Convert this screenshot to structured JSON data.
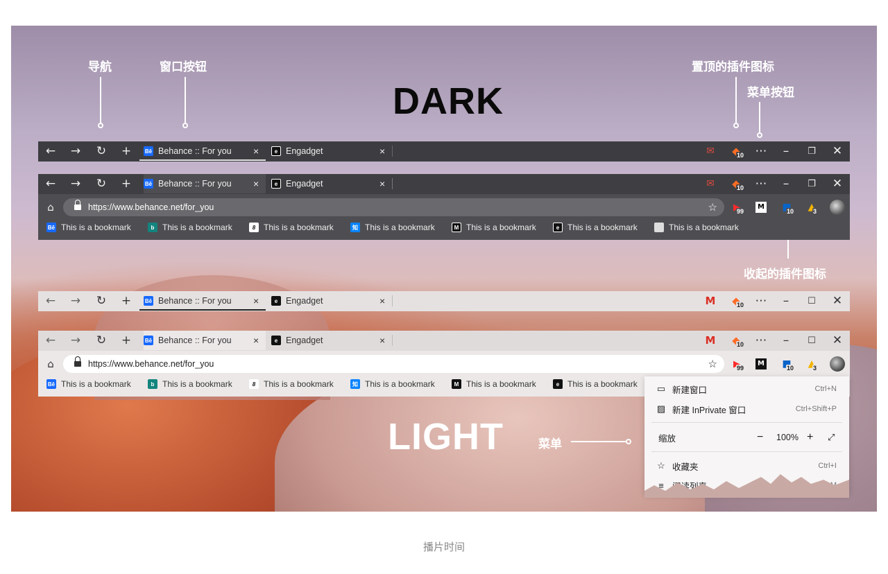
{
  "annotations": {
    "nav": "导航",
    "window_buttons": "窗口按钮",
    "pinned_extensions": "置顶的插件图标",
    "menu_button": "菜单按钮",
    "collapsed_extensions": "收起的插件图标",
    "menu": "菜单"
  },
  "headings": {
    "dark": "DARK",
    "light": "LIGHT"
  },
  "tabs": [
    {
      "label": "Behance :: For you",
      "favicon": "Bē",
      "active": true
    },
    {
      "label": "Engadget",
      "favicon": "e",
      "active": false
    }
  ],
  "address": {
    "url": "https://www.behance.net/for_you"
  },
  "extensions_pinned": [
    {
      "icon": "gmail-icon"
    },
    {
      "icon": "gitlab-icon",
      "badge": "10"
    }
  ],
  "extensions_toolbar": [
    {
      "icon": "youtube-icon",
      "badge": "99"
    },
    {
      "icon": "medium-icon"
    },
    {
      "icon": "outlook-icon",
      "badge": "10"
    },
    {
      "icon": "drive-icon",
      "badge": "3"
    },
    {
      "icon": "avatar"
    }
  ],
  "bookmarks": [
    {
      "label": "This is a bookmark",
      "icon": "Bē",
      "color": "#1769ff"
    },
    {
      "label": "This is a bookmark",
      "icon": "b",
      "color": "#13847e"
    },
    {
      "label": "This is a bookmark",
      "icon": "8",
      "color": "#111111"
    },
    {
      "label": "This is a bookmark",
      "icon": "知",
      "color": "#0a84ff"
    },
    {
      "label": "This is a bookmark",
      "icon": "M",
      "color": "#111111"
    },
    {
      "label": "This is a bookmark",
      "icon": "e",
      "color": "#111111"
    },
    {
      "label": "This is a bookmark",
      "icon": "",
      "color": "#888888"
    }
  ],
  "menu": {
    "items": [
      {
        "label": "新建窗口",
        "shortcut": "Ctrl+N",
        "icon": "window-icon"
      },
      {
        "label": "新建 InPrivate 窗口",
        "shortcut": "Ctrl+Shift+P",
        "icon": "inprivate-icon"
      },
      {
        "label": "缩放",
        "zoom": "100%"
      },
      {
        "label": "收藏夹",
        "shortcut": "Ctrl+I",
        "icon": "favorites-icon"
      },
      {
        "label": "阅读列表",
        "shortcut": "Ctrl+M",
        "icon": "reading-list-icon"
      }
    ]
  },
  "caption": "播片时间",
  "colors": {
    "dark_bar": "#4a4a4e",
    "dark_tabs": "#3b3b3f",
    "light_bar": "#e8e4e4",
    "accent": "#1769ff"
  }
}
